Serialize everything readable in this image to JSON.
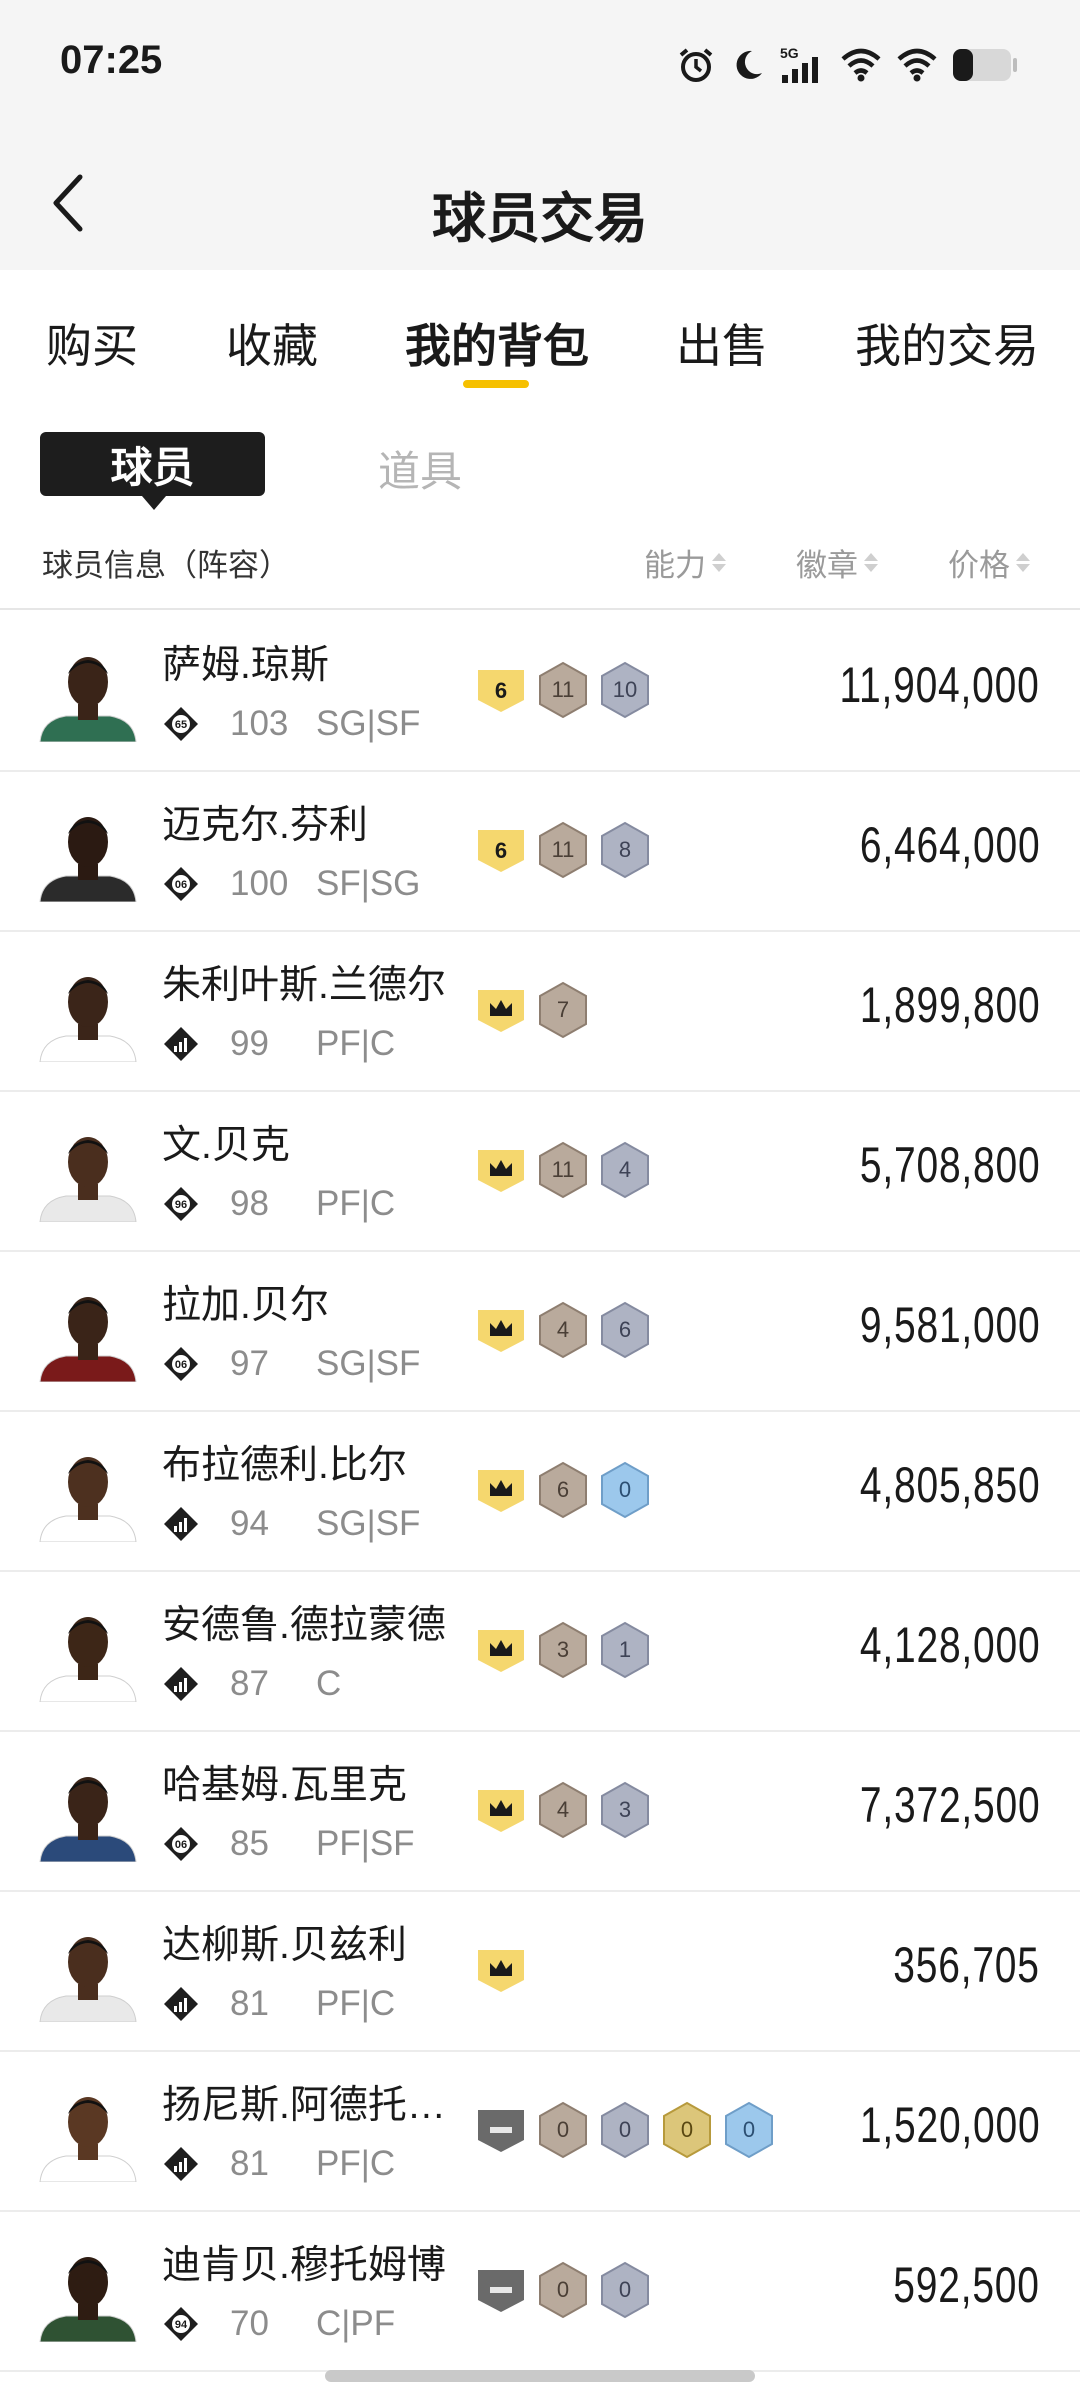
{
  "status_bar": {
    "time": "07:25",
    "network": "5G",
    "battery_level": 0.3
  },
  "nav": {
    "title": "球员交易"
  },
  "tabs": [
    {
      "label": "购买",
      "active": false
    },
    {
      "label": "收藏",
      "active": false
    },
    {
      "label": "我的背包",
      "active": true
    },
    {
      "label": "出售",
      "active": false
    },
    {
      "label": "我的交易",
      "active": false
    }
  ],
  "subtabs": {
    "active": "球员",
    "inactive": "道具"
  },
  "columns": {
    "info": "球员信息（阵容）",
    "ability": "能力",
    "badges": "徽章",
    "price": "价格"
  },
  "colors": {
    "accent": "#f6c000",
    "gold_badge": "#f5d76e",
    "bronze_hex": "#b9aa9c",
    "silver_hex": "#a8adbd",
    "blue_hex": "#8fbde6",
    "dark_shield": "#6a6a6a"
  },
  "players": [
    {
      "name": "萨姆.琼斯",
      "rating_badge": "65",
      "ability": "103",
      "position": "SG|SF",
      "badges": [
        {
          "kind": "shield",
          "value": "6"
        },
        {
          "kind": "bronze",
          "value": "11"
        },
        {
          "kind": "silver",
          "value": "10"
        }
      ],
      "price": "11,904,000"
    },
    {
      "name": "迈克尔.芬利",
      "rating_badge": "06",
      "ability": "100",
      "position": "SF|SG",
      "badges": [
        {
          "kind": "shield",
          "value": "6"
        },
        {
          "kind": "bronze",
          "value": "11"
        },
        {
          "kind": "silver",
          "value": "8"
        }
      ],
      "price": "6,464,000"
    },
    {
      "name": "朱利叶斯.兰德尔",
      "rating_badge": "bars",
      "ability": "99",
      "position": "PF|C",
      "badges": [
        {
          "kind": "crown",
          "value": ""
        },
        {
          "kind": "bronze",
          "value": "7"
        }
      ],
      "price": "1,899,800"
    },
    {
      "name": "文.贝克",
      "rating_badge": "96",
      "ability": "98",
      "position": "PF|C",
      "badges": [
        {
          "kind": "crown",
          "value": ""
        },
        {
          "kind": "bronze",
          "value": "11"
        },
        {
          "kind": "silver",
          "value": "4"
        }
      ],
      "price": "5,708,800"
    },
    {
      "name": "拉加.贝尔",
      "rating_badge": "06",
      "ability": "97",
      "position": "SG|SF",
      "badges": [
        {
          "kind": "crown",
          "value": ""
        },
        {
          "kind": "bronze",
          "value": "4"
        },
        {
          "kind": "silver",
          "value": "6"
        }
      ],
      "price": "9,581,000"
    },
    {
      "name": "布拉德利.比尔",
      "rating_badge": "bars",
      "ability": "94",
      "position": "SG|SF",
      "badges": [
        {
          "kind": "crown",
          "value": ""
        },
        {
          "kind": "bronze",
          "value": "6"
        },
        {
          "kind": "blue",
          "value": "0"
        }
      ],
      "price": "4,805,850"
    },
    {
      "name": "安德鲁.德拉蒙德",
      "rating_badge": "bars",
      "ability": "87",
      "position": "C",
      "badges": [
        {
          "kind": "crown",
          "value": ""
        },
        {
          "kind": "bronze",
          "value": "3"
        },
        {
          "kind": "silver",
          "value": "1"
        }
      ],
      "price": "4,128,000"
    },
    {
      "name": "哈基姆.瓦里克",
      "rating_badge": "06",
      "ability": "85",
      "position": "PF|SF",
      "badges": [
        {
          "kind": "crown",
          "value": ""
        },
        {
          "kind": "bronze",
          "value": "4"
        },
        {
          "kind": "silver",
          "value": "3"
        }
      ],
      "price": "7,372,500"
    },
    {
      "name": "达柳斯.贝兹利",
      "rating_badge": "bars",
      "ability": "81",
      "position": "PF|C",
      "badges": [
        {
          "kind": "crown",
          "value": ""
        }
      ],
      "price": "356,705"
    },
    {
      "name": "扬尼斯.阿德托…",
      "rating_badge": "bars",
      "ability": "81",
      "position": "PF|C",
      "badges": [
        {
          "kind": "dash",
          "value": ""
        },
        {
          "kind": "bronze",
          "value": "0"
        },
        {
          "kind": "silver",
          "value": "0"
        },
        {
          "kind": "gold",
          "value": "0"
        },
        {
          "kind": "blue",
          "value": "0"
        }
      ],
      "price": "1,520,000"
    },
    {
      "name": "迪肯贝.穆托姆博",
      "rating_badge": "94",
      "ability": "70",
      "position": "C|PF",
      "badges": [
        {
          "kind": "dash",
          "value": ""
        },
        {
          "kind": "bronze",
          "value": "0"
        },
        {
          "kind": "silver",
          "value": "0"
        }
      ],
      "price": "592,500"
    }
  ]
}
